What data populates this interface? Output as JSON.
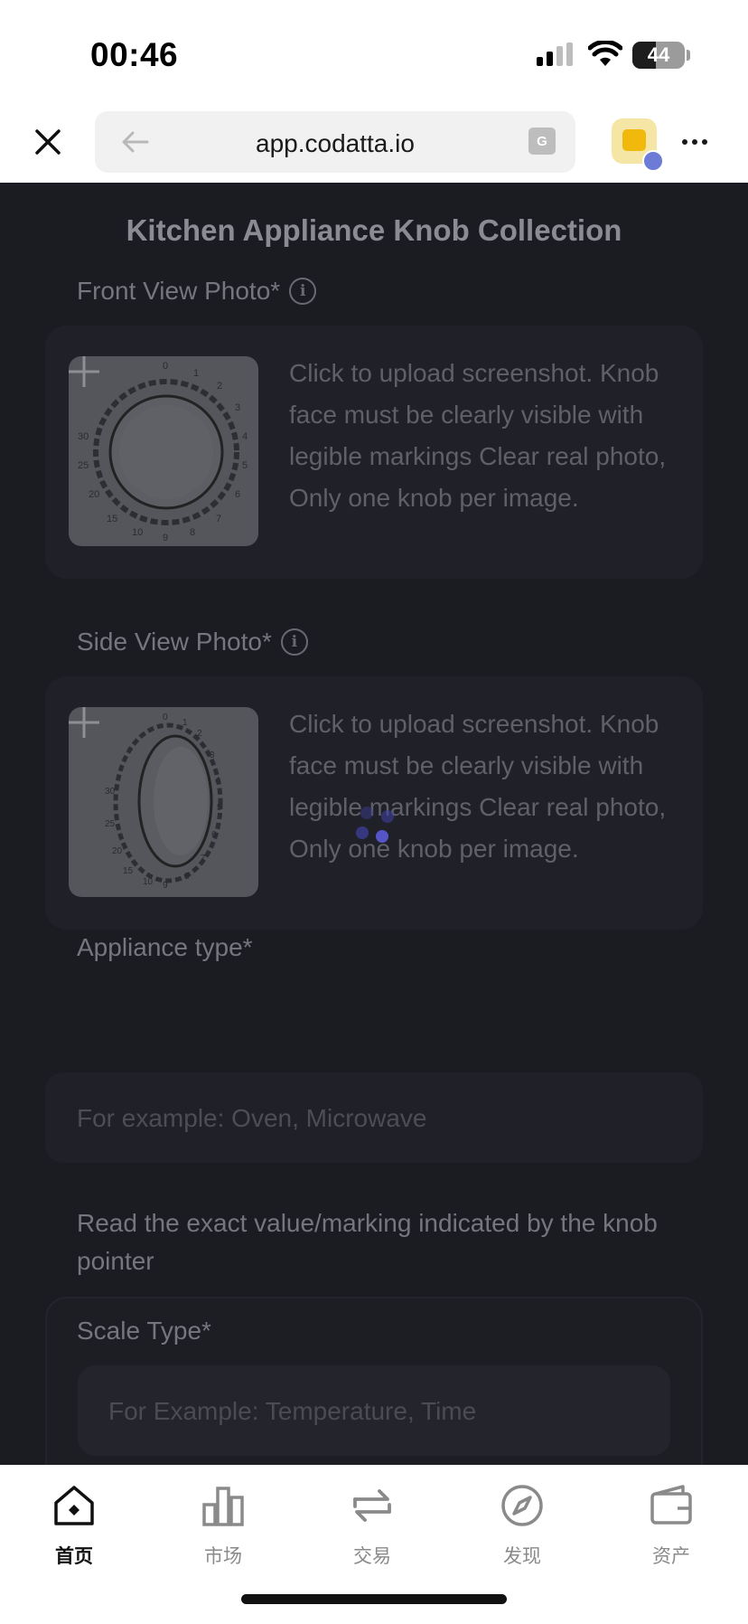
{
  "status_bar": {
    "time": "00:46",
    "battery_level": "44"
  },
  "browser": {
    "url": "app.codatta.io",
    "icons": [
      "close-icon",
      "back-arrow-icon",
      "translate-icon",
      "wallet-icon",
      "more-icon"
    ]
  },
  "page": {
    "title": "Kitchen Appliance Knob Collection",
    "front_view": {
      "label": "Front View Photo*",
      "hint": "Click to upload screenshot. Knob face must be clearly visible with legible markings Clear real photo, Only one knob per image."
    },
    "side_view": {
      "label": "Side View Photo*",
      "hint": "Click to upload screenshot. Knob face must be clearly visible with legible markings Clear real photo, Only one knob per image."
    },
    "appliance_type": {
      "label": "Appliance type*",
      "placeholder": "For example: Oven, Microwave"
    },
    "instruction": "Read the exact value/marking indicated by the knob pointer",
    "scale_type": {
      "label": "Scale Type*",
      "placeholder": "For Example: Temperature, Time"
    }
  },
  "bottom_nav": [
    {
      "label": "首页",
      "icon": "home-icon",
      "active": true
    },
    {
      "label": "市场",
      "icon": "chart-icon",
      "active": false
    },
    {
      "label": "交易",
      "icon": "swap-icon",
      "active": false
    },
    {
      "label": "发现",
      "icon": "compass-icon",
      "active": false
    },
    {
      "label": "资产",
      "icon": "wallet-icon",
      "active": false
    }
  ],
  "colors": {
    "overlay_background": "#1b1c22",
    "card_background": "#202128",
    "wallet_accent": "#f0b90b",
    "spinner": "#3f3f9c"
  }
}
